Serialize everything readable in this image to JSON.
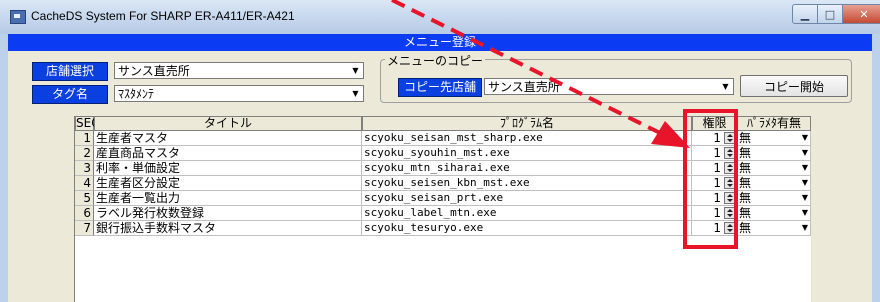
{
  "window": {
    "title": "CacheDS System For SHARP ER-A411/ER-A421"
  },
  "menu_header": "メニュー登録",
  "store": {
    "label": "店舗選択",
    "value": "サンス直売所"
  },
  "tag": {
    "label": "タグ名",
    "value": "ﾏｽﾀﾒﾝﾃ"
  },
  "copy": {
    "group_label": "メニューのコピー",
    "dest_label": "コピー先店舗",
    "dest_value": "サンス直売所",
    "start_button": "コピー開始"
  },
  "table": {
    "headers": {
      "seq": "SEQ",
      "title": "タイトル",
      "program": "ﾌﾟﾛｸﾞﾗﾑ名",
      "permission": "権限",
      "param": "ﾊﾟﾗﾒﾀ有無"
    },
    "rows": [
      {
        "seq": "1",
        "title": "生産者マスタ",
        "program": "scyoku_seisan_mst_sharp.exe",
        "permission": "1",
        "param": "無"
      },
      {
        "seq": "2",
        "title": "産直商品マスタ",
        "program": "scyoku_syouhin_mst.exe",
        "permission": "1",
        "param": "無"
      },
      {
        "seq": "3",
        "title": "利率・単価設定",
        "program": "scyoku_mtn_siharai.exe",
        "permission": "1",
        "param": "無"
      },
      {
        "seq": "4",
        "title": "生産者区分設定",
        "program": "scyoku_seisen_kbn_mst.exe",
        "permission": "1",
        "param": "無"
      },
      {
        "seq": "5",
        "title": "生産者一覧出力",
        "program": "scyoku_seisan_prt.exe",
        "permission": "1",
        "param": "無"
      },
      {
        "seq": "6",
        "title": "ラベル発行枚数登録",
        "program": "scyoku_label_mtn.exe",
        "permission": "1",
        "param": "無"
      },
      {
        "seq": "7",
        "title": "銀行振込手数料マスタ",
        "program": "scyoku_tesuryo.exe",
        "permission": "1",
        "param": "無"
      }
    ]
  },
  "colors": {
    "header_blue": "#0b3cf4",
    "annotation_red": "#e8152a"
  }
}
